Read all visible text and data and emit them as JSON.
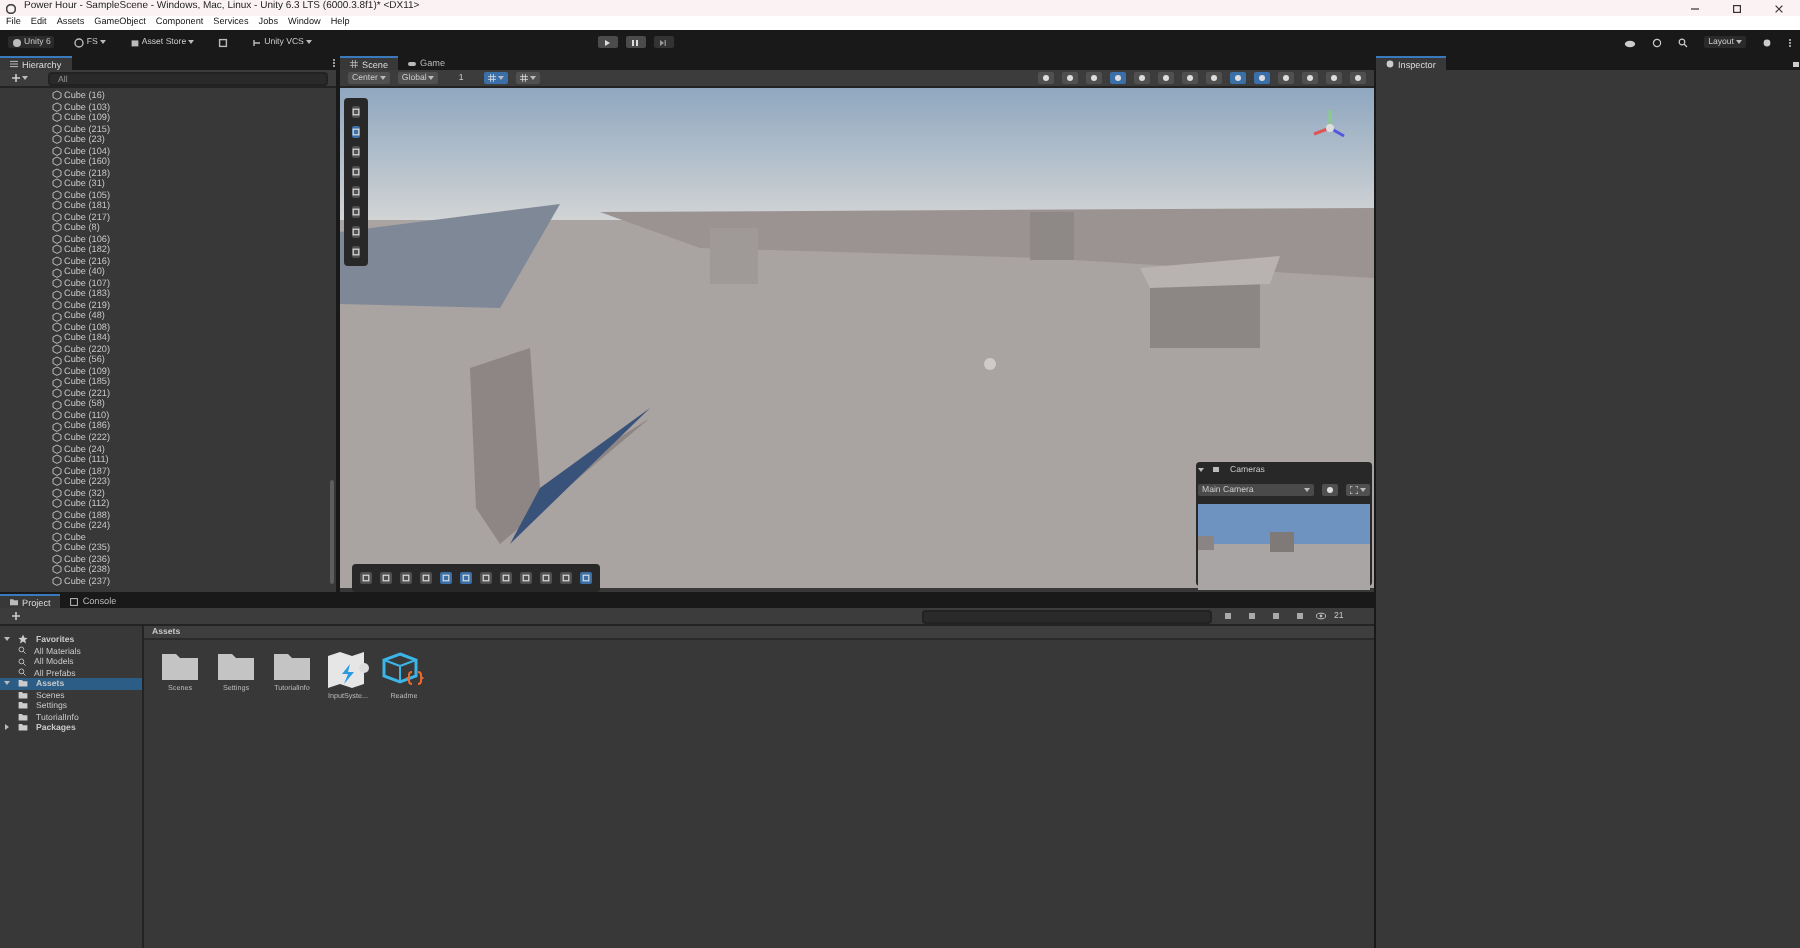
{
  "window": {
    "title": "Power Hour - SampleScene - Windows, Mac, Linux - Unity 6.3 LTS (6000.3.8f1)* <DX11>"
  },
  "menu": [
    "File",
    "Edit",
    "Assets",
    "GameObject",
    "Component",
    "Services",
    "Jobs",
    "Window",
    "Help"
  ],
  "toolbar": {
    "account": "Unity 6",
    "user": "FS",
    "asset_store": "Asset Store",
    "vcs": "Unity VCS",
    "layout": "Layout"
  },
  "hierarchy": {
    "title": "Hierarchy",
    "search_placeholder": "All",
    "items": [
      "Cube (16)",
      "Cube (103)",
      "Cube (109)",
      "Cube (215)",
      "Cube (23)",
      "Cube (104)",
      "Cube (160)",
      "Cube (218)",
      "Cube (31)",
      "Cube (105)",
      "Cube (181)",
      "Cube (217)",
      "Cube (8)",
      "Cube (106)",
      "Cube (182)",
      "Cube (216)",
      "Cube (40)",
      "Cube (107)",
      "Cube (183)",
      "Cube (219)",
      "Cube (48)",
      "Cube (108)",
      "Cube (184)",
      "Cube (220)",
      "Cube (56)",
      "Cube (109)",
      "Cube (185)",
      "Cube (221)",
      "Cube (58)",
      "Cube (110)",
      "Cube (186)",
      "Cube (222)",
      "Cube (24)",
      "Cube (111)",
      "Cube (187)",
      "Cube (223)",
      "Cube (32)",
      "Cube (112)",
      "Cube (188)",
      "Cube (224)",
      "Cube",
      "Cube (235)",
      "Cube (236)",
      "Cube (238)",
      "Cube (237)"
    ]
  },
  "scene_tabs": [
    {
      "label": "Scene",
      "selected": true
    },
    {
      "label": "Game",
      "selected": false
    }
  ],
  "scene_toolbar": {
    "pivot": "Center",
    "space": "Global",
    "snap": "1"
  },
  "cameras_overlay": {
    "title": "Cameras",
    "camera": "Main Camera"
  },
  "inspector": {
    "title": "Inspector"
  },
  "bottom_tabs": [
    {
      "label": "Project",
      "selected": true
    },
    {
      "label": "Console",
      "selected": false
    }
  ],
  "project_tree": [
    {
      "label": "Favorites",
      "kind": "favorites",
      "expanded": true,
      "selected": false,
      "children": [
        {
          "label": "All Materials"
        },
        {
          "label": "All Models"
        },
        {
          "label": "All Prefabs"
        }
      ]
    },
    {
      "label": "Assets",
      "kind": "folder",
      "expanded": true,
      "selected": true,
      "children": [
        {
          "label": "Scenes"
        },
        {
          "label": "Settings"
        },
        {
          "label": "TutorialInfo"
        }
      ]
    },
    {
      "label": "Packages",
      "kind": "folder",
      "expanded": false,
      "selected": false
    }
  ],
  "assets_path": "Assets",
  "hidden_count": "21",
  "assets": [
    {
      "name": "Scenes",
      "kind": "folder"
    },
    {
      "name": "Settings",
      "kind": "folder"
    },
    {
      "name": "TutorialInfo",
      "kind": "folder"
    },
    {
      "name": "InputSyste...",
      "kind": "input-actions"
    },
    {
      "name": "Readme",
      "kind": "readme"
    }
  ]
}
